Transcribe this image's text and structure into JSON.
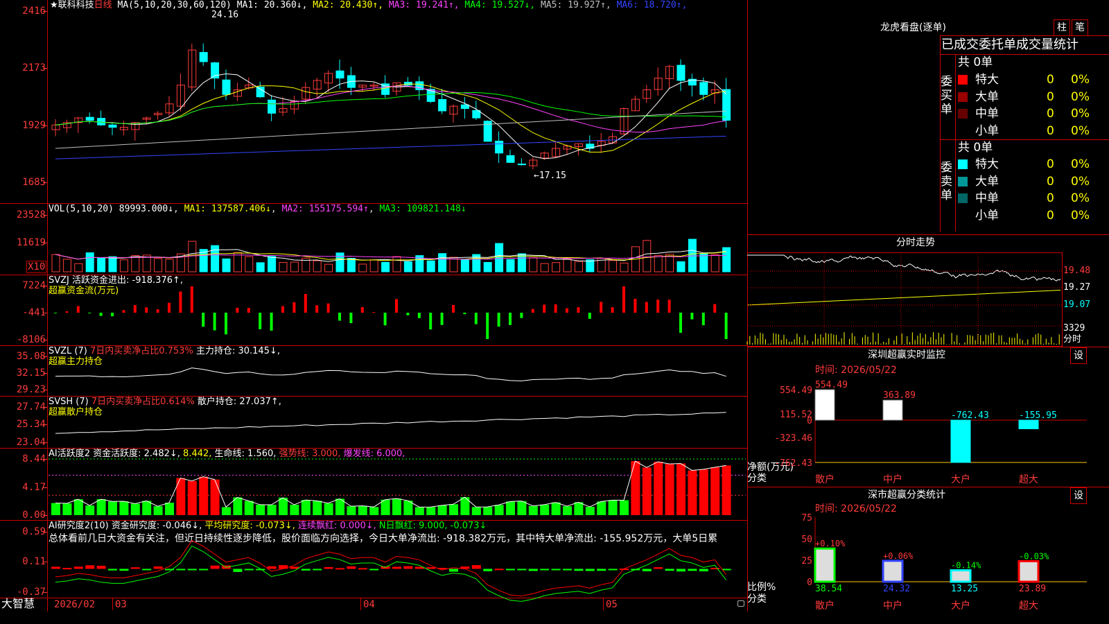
{
  "stock": {
    "name": "★联科科技",
    "period": "日线"
  },
  "main_legend": {
    "ma": "MA(5,10,20,30,60,120)",
    "items": [
      {
        "text": "MA1: 20.360↓",
        "color": "#ffffff"
      },
      {
        "text": "MA2: 20.430↑",
        "color": "#ffff00"
      },
      {
        "text": "MA3: 19.241↑",
        "color": "#ff44ff"
      },
      {
        "text": "MA4: 19.527↓",
        "color": "#00ff00"
      },
      {
        "text": "MA5: 19.927↑",
        "color": "#c0c0c0"
      },
      {
        "text": "MA6: 18.720↑",
        "color": "#3344ff"
      }
    ],
    "high_label": "24.16",
    "low_label": "17.15"
  },
  "yaxis": {
    "main": [
      "2416",
      "2173",
      "1929",
      "1685"
    ],
    "vol": [
      "23528",
      "11619"
    ],
    "vol_unit": "X10",
    "svzj": [
      "7224",
      "-441",
      "-8106"
    ],
    "svzl": [
      "35.08",
      "32.15",
      "29.23"
    ],
    "svsh": [
      "27.74",
      "25.34",
      "23.04"
    ],
    "ai": [
      "8.44",
      "4.17",
      "0.00"
    ],
    "ai2": [
      "0.59",
      "0.11",
      "-0.37"
    ]
  },
  "vol_legend": {
    "name": "VOL(5,10,20)",
    "v": "89993.000↓",
    "ma1": "MA1: 137587.406↓",
    "ma2": "MA2: 155175.594↑",
    "ma3": "MA3: 109821.148↓"
  },
  "svzj_legend": {
    "name": "SVZJ",
    "text": "活跃资金进出: -918.376↑,",
    "sub": "超赢资金流(万元)"
  },
  "svzl_legend": {
    "name": "SVZL (7)",
    "a": "7日内买卖净占比0.753%",
    "b": "主力持仓: 30.145↓,",
    "sub": "超赢主力持仓"
  },
  "svsh_legend": {
    "name": "SVSH (7)",
    "a": "7日内买卖净占比0.614%",
    "b": "散户持仓: 27.037↑,",
    "sub": "超赢散户持仓"
  },
  "ai_legend": {
    "name": "AI活跃度2",
    "a": "资金活跃度: 2.482↓,",
    "b": "8.442,",
    "c": "生命线: 1.560,",
    "d": "强势线: 3.000,",
    "e": "爆发线: 6.000,"
  },
  "ai2_legend": {
    "name": "AI研究度2(10)",
    "a": "资金研究度: -0.046↓,",
    "b": "平均研究度: -0.073↓,",
    "c": "连续飘红: 0.000↓,",
    "d": "N日飘红: 9.000, -0.073↓",
    "comment": "总体看前几日大资金有关注，但近日持续性逐步降低，股价面临方向选择，今日大单净流出: -918.382万元，其中特大单净流出: -155.952万元，大单5日累"
  },
  "xaxis": {
    "brand": "大智慧",
    "labels": [
      "2026/02",
      "03",
      "04",
      "05"
    ]
  },
  "right": {
    "lhb_title": "龙虎看盘(逐单)",
    "btn_zhu": "柱",
    "btn_bi": "笔",
    "tabs": "已成交委托单成交量统计",
    "buy": {
      "side": "委买单",
      "total": "共 0单",
      "rows": [
        {
          "label": "特大",
          "v": "0",
          "p": "0%",
          "color": "#ff0000"
        },
        {
          "label": "大单",
          "v": "0",
          "p": "0%",
          "color": "#990000"
        },
        {
          "label": "中单",
          "v": "0",
          "p": "0%",
          "color": "#660000"
        },
        {
          "label": "小单",
          "v": "0",
          "p": "0%",
          "color": "#000000"
        }
      ]
    },
    "sell": {
      "side": "委卖单",
      "total": "共 0单",
      "rows": [
        {
          "label": "特大",
          "v": "0",
          "p": "0%",
          "color": "#00ffff"
        },
        {
          "label": "大单",
          "v": "0",
          "p": "0%",
          "color": "#009999"
        },
        {
          "label": "中单",
          "v": "0",
          "p": "0%",
          "color": "#006666"
        },
        {
          "label": "小单",
          "v": "0",
          "p": "0%",
          "color": "#000000"
        }
      ]
    },
    "fs_title": "分时走势",
    "fs_y": [
      "19.48",
      "19.27",
      "19.07"
    ],
    "fs_vol": "3329",
    "fs_unit": "分时",
    "mon_title": "深圳超赢实时监控",
    "mon_btn": "设",
    "mon_time": "时间: 2026/05/22",
    "mon_y": [
      "554.49",
      "115.52",
      "0",
      "-323.46",
      "-762.43"
    ],
    "mon_ylab": "净额(万元)",
    "mon_xlab": "分类",
    "cls_title": "深市超赢分类统计",
    "cls_btn": "设",
    "cls_time": "时间: 2026/05/22",
    "cls_y": [
      "75",
      "50",
      "25",
      "0"
    ],
    "cls_ylab": "比例%",
    "cls_xlab": "分类"
  },
  "chart_data": [
    {
      "type": "bar",
      "title": "深圳超赢实时监控",
      "ylabel": "净额(万元)",
      "xlabel": "分类",
      "categories": [
        "散户",
        "中户",
        "大户",
        "超大"
      ],
      "values": [
        554.49,
        363.89,
        -762.43,
        -155.95
      ],
      "ylim": [
        -762.43,
        554.49
      ]
    },
    {
      "type": "bar",
      "title": "深市超赢分类统计",
      "ylabel": "比例%",
      "xlabel": "分类",
      "categories": [
        "散户",
        "中户",
        "大户",
        "超大"
      ],
      "values": [
        38.54,
        24.32,
        13.25,
        23.89
      ],
      "change": [
        "+0.10%",
        "+0.06%",
        "-0.14%",
        "-0.03%"
      ],
      "ylim": [
        0,
        75
      ]
    }
  ]
}
